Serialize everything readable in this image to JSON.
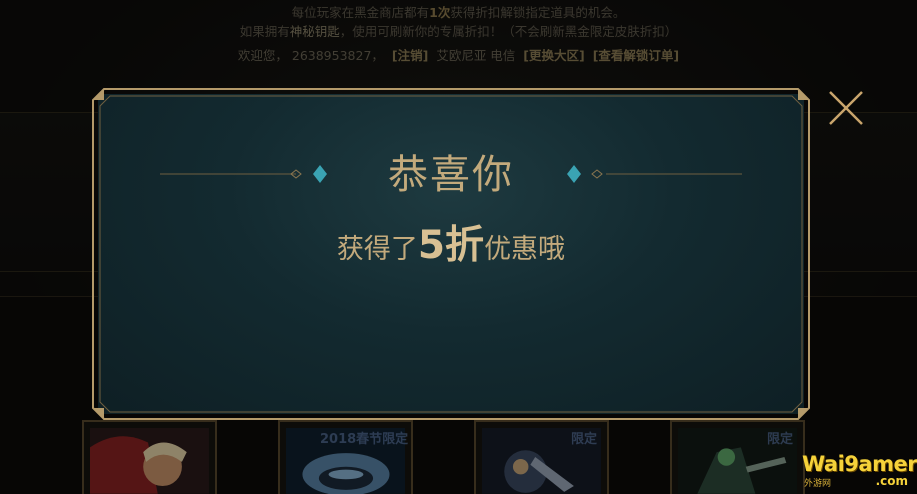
{
  "notice": {
    "line1_a": "每位玩家在黑金商店都有",
    "line1_b": "1次",
    "line1_c": "获得折扣解锁指定道具的机会。",
    "line2_a": "如果拥有",
    "line2_b": "神秘钥匙",
    "line2_c": "，使用可刷新你的专属折扣！（不会刷新黑金限定皮肤折扣）"
  },
  "welcome": {
    "greeting": "欢迎您，",
    "account": "2638953827，",
    "logout": "[注销]",
    "server": "艾欧尼亚 电信",
    "change_region": "[更换大区]",
    "view_orders": "[查看解锁订单]"
  },
  "modal": {
    "title": "恭喜你",
    "sub_before": "获得了",
    "discount": "5折",
    "sub_after": "优惠哦",
    "close_icon": "close-x-icon"
  },
  "cards": [
    {
      "tag": ""
    },
    {
      "tag": "2018春节限定"
    },
    {
      "tag": "限定"
    },
    {
      "tag": "限定"
    }
  ],
  "watermark": {
    "main": "Wai9amer",
    "sub": "外游网",
    "com": ".com"
  },
  "colors": {
    "gold": "#c3aa7c",
    "teal": "#132a30",
    "frame": "#b49a6a",
    "diamond": "#3aa3b3"
  }
}
